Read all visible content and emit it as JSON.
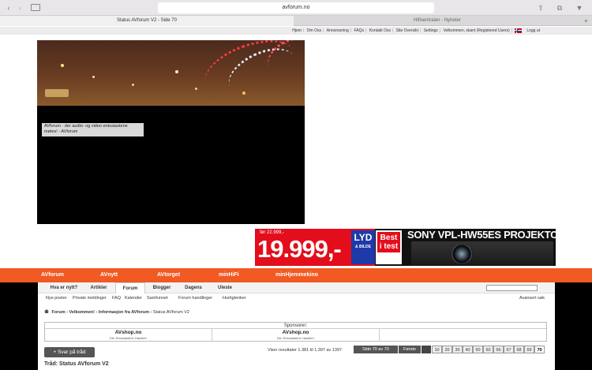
{
  "browser": {
    "url": "avforum.no",
    "tabs": [
      {
        "label": "Status AVforum V2 - Side 70"
      },
      {
        "label": "Hifisentralen - Nyheter"
      }
    ]
  },
  "top_links": [
    "Hjem",
    "Om Oss",
    "Annonsering",
    "FAQs",
    "Kontakt Oss",
    "Site Oversikt",
    "Settings",
    "Velkommen, skant (Registered Users)"
  ],
  "logout": "Logg ut",
  "tagline": "AVforum - der audio- og video entusiastene møtes! - AVforum",
  "ad": {
    "before": "før 22.999,-",
    "price": "19.999,-",
    "lyd_top": "LYD",
    "lyd_bottom": "& BILDE",
    "best_line1": "Best",
    "best_line2": "i test",
    "brand": "SONY VPL-HW55ES PROJEKTOR"
  },
  "main_nav": [
    "AVforum",
    "AVnytt",
    "AVtorget",
    "minHiFi",
    "minHjemmekino"
  ],
  "forum_tabs": [
    "Hva er nytt?",
    "Artikler",
    "Forum",
    "Blogger",
    "Dagens",
    "Uleste"
  ],
  "advanced_search": "Avansert søk",
  "subnav": [
    "Nye poster",
    "Private meldinger",
    "FAQ",
    "Kalender",
    "Samfunnet",
    "Forum handlinger",
    "Hurtiglenker"
  ],
  "breadcrumb": [
    "Forum",
    "Velkommen!",
    "Informasjon fra AVforum",
    "Status AVforum V2"
  ],
  "sponsors": {
    "heading": "Sponsorer:",
    "items": [
      {
        "name": "AVshop.no",
        "sub": "Der Entusiastene Handler!"
      },
      {
        "name": "AVshop.no",
        "sub": "Der Entusiastene Handler!"
      }
    ]
  },
  "reply_button": "+ Svar på tråd",
  "results": "Viser resultater 1.381 til 1.397 av 1397",
  "pager": {
    "page_label": "Side 70 av 70",
    "first": "Første",
    "pages": [
      "10",
      "20",
      "30",
      "40",
      "50",
      "60",
      "66",
      "67",
      "68",
      "69",
      "70"
    ],
    "current": "70"
  },
  "thread_title": "Tråd: Status AVforum V2",
  "colors": {
    "orange": "#f15a22",
    "ad_red": "#e30d1c"
  }
}
